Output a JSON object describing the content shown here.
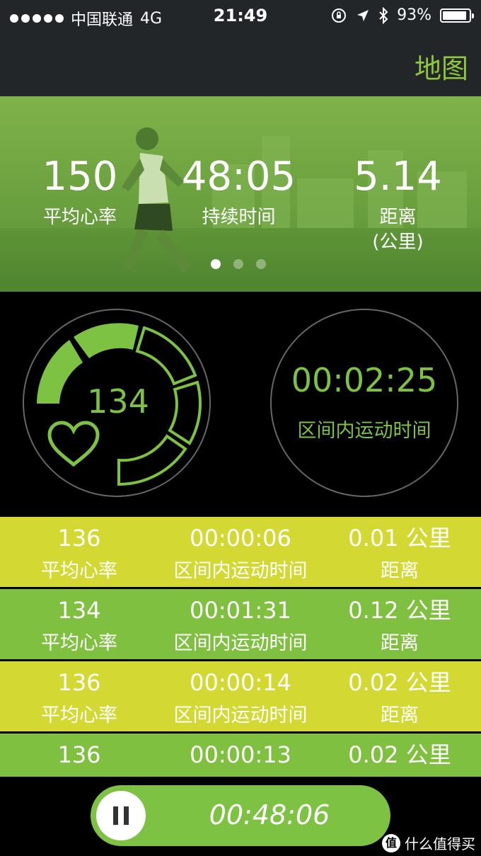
{
  "status_bar": {
    "carrier": "中国联通",
    "network": "4G",
    "time": "21:49",
    "battery": "93%",
    "battery_level": 0.93
  },
  "nav": {
    "map_label": "地图"
  },
  "summary": {
    "stats": [
      {
        "value": "150",
        "label": "平均心率"
      },
      {
        "value": "48:05",
        "label": "持续时间"
      },
      {
        "value": "5.14",
        "label": "距离",
        "sub": "(公里)"
      }
    ],
    "page_count": 3,
    "active_page": 0
  },
  "heart_rate": {
    "value": "134"
  },
  "zone": {
    "time": "00:02:25",
    "label": "区间内运动时间"
  },
  "laps": [
    {
      "hr": "136",
      "hr_label": "平均心率",
      "time": "00:00:06",
      "time_label": "区间内运动时间",
      "dist": "0.01 公里",
      "dist_label": "距离"
    },
    {
      "hr": "134",
      "hr_label": "平均心率",
      "time": "00:01:31",
      "time_label": "区间内运动时间",
      "dist": "0.12 公里",
      "dist_label": "距离"
    },
    {
      "hr": "136",
      "hr_label": "平均心率",
      "time": "00:00:14",
      "time_label": "区间内运动时间",
      "dist": "0.02 公里",
      "dist_label": "距离"
    },
    {
      "hr": "136",
      "time": "00:00:13",
      "dist": "0.02 公里"
    }
  ],
  "workout": {
    "elapsed": "00:48:06"
  },
  "watermark": {
    "text": "什么值得买",
    "logo": "值"
  },
  "colors": {
    "accent": "#7dc242",
    "row_yellow": "#d4d832",
    "row_green": "#80c040",
    "bar": "#232628"
  }
}
